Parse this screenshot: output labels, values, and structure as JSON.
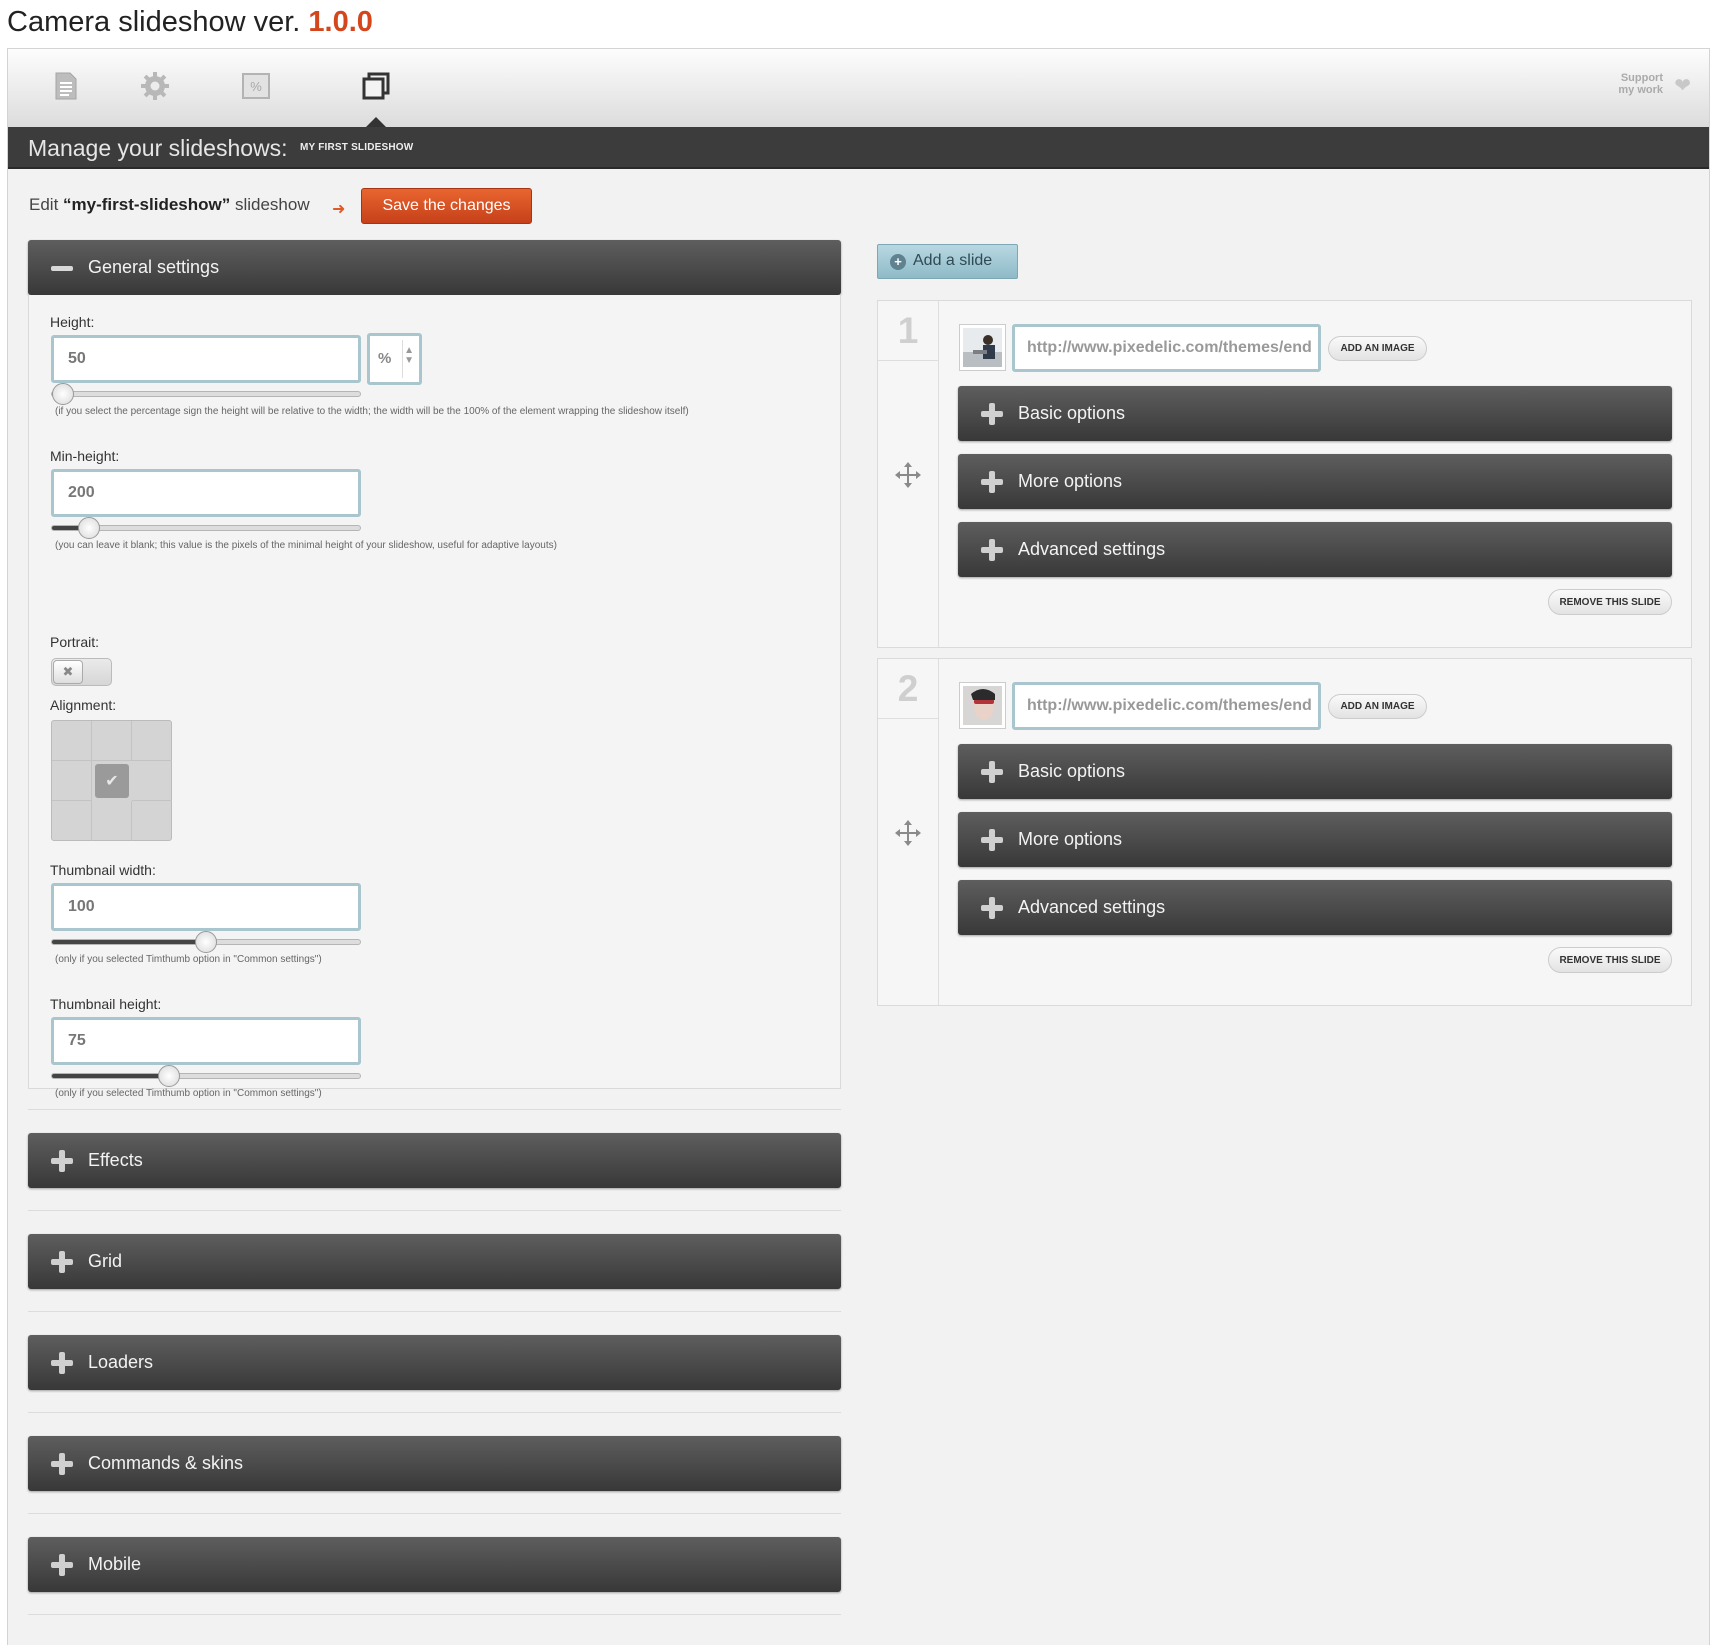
{
  "header": {
    "title": "Camera slideshow ver.",
    "version": "1.0.0"
  },
  "topbar": {
    "tabs": [
      {
        "icon": "document-icon"
      },
      {
        "icon": "gear-icon"
      },
      {
        "icon": "percent-image-icon"
      },
      {
        "icon": "slideshows-icon",
        "active": true
      }
    ],
    "support_line1": "Support",
    "support_line2": "my work"
  },
  "manage": {
    "title": "Manage your slideshows:",
    "selected": "MY FIRST SLIDESHOW"
  },
  "edit": {
    "prefix": "Edit",
    "name": "“my-first-slideshow”",
    "suffix": "slideshow",
    "save_label": "Save the changes"
  },
  "general": {
    "title": "General settings",
    "height": {
      "label": "Height:",
      "value": "50",
      "unit": "%",
      "slider": 0.0,
      "hint": "(if you select the percentage sign the height will be relative to the width; the width will be the 100% of the element wrapping the slideshow itself)"
    },
    "min_height": {
      "label": "Min-height:",
      "value": "200",
      "slider": 0.09,
      "hint": "(you can leave it blank; this value is the pixels of the minimal height of your slideshow, useful for adaptive layouts)"
    },
    "portrait": {
      "label": "Portrait:",
      "on": false
    },
    "alignment": {
      "label": "Alignment:",
      "selected": "center"
    },
    "thumb_width": {
      "label": "Thumbnail width:",
      "value": "100",
      "slider": 0.5,
      "hint": "(only if you selected Timthumb option in \"Common settings\")"
    },
    "thumb_height": {
      "label": "Thumbnail height:",
      "value": "75",
      "slider": 0.37,
      "hint": "(only if you selected Timthumb option in \"Common settings\")"
    }
  },
  "sections": [
    "Effects",
    "Grid",
    "Loaders",
    "Commands & skins",
    "Mobile"
  ],
  "slides_panel": {
    "add_label": "Add a slide",
    "add_image_label": "ADD AN IMAGE",
    "remove_label": "REMOVE THIS SLIDE",
    "options": [
      "Basic options",
      "More options",
      "Advanced settings"
    ],
    "slides": [
      {
        "number": "1",
        "url": "http://www.pixedelic.com/themes/end"
      },
      {
        "number": "2",
        "url": "http://www.pixedelic.com/themes/end"
      }
    ]
  },
  "colors": {
    "accent": "#d4461c",
    "bar_dark": "#3c3c3c",
    "input_border": "#a9c6cf"
  }
}
